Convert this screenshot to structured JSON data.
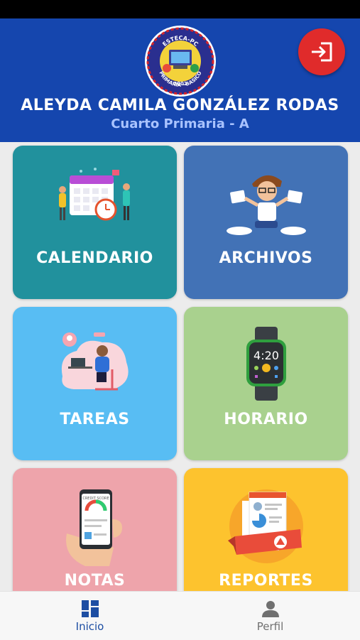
{
  "header": {
    "student_name": "ALEYDA CAMILA GONZÁLEZ RODAS",
    "grade": "Cuarto Primaria - A",
    "logo": {
      "top_text": "ESTECA-PC",
      "right_text": "DIVERSIFICADO",
      "bottom_text": "PRIMARIA · BASICO",
      "year": "2002"
    },
    "logout_icon": "logout-icon",
    "accent": "#1546ae",
    "logout_color": "#e02b2b"
  },
  "tiles": [
    {
      "label": "CALENDARIO",
      "color": "#21919d",
      "icon": "calendar-illustration"
    },
    {
      "label": "ARCHIVOS",
      "color": "#4272b6",
      "icon": "files-illustration"
    },
    {
      "label": "TAREAS",
      "color": "#58bdf3",
      "icon": "homework-illustration"
    },
    {
      "label": "HORARIO",
      "color": "#a9d18e",
      "icon": "smartwatch-illustration",
      "watch_time": "4:20"
    },
    {
      "label": "NOTAS",
      "color": "#eea4ab",
      "icon": "phone-grades-illustration",
      "phone_caption": "CREDIT SCORE"
    },
    {
      "label": "REPORTES",
      "color": "#fdc32e",
      "icon": "report-illustration"
    }
  ],
  "bottom_nav": [
    {
      "label": "Inicio",
      "icon": "dashboard-icon",
      "active": true,
      "color": "#1d4ea3"
    },
    {
      "label": "Perfil",
      "icon": "person-icon",
      "active": false,
      "color": "#707070"
    }
  ]
}
